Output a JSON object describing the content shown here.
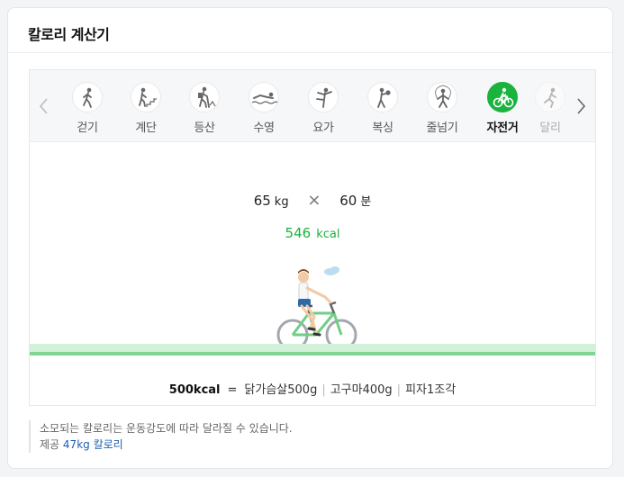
{
  "card": {
    "title": "칼로리 계산기"
  },
  "tabs": [
    {
      "label": "걷기",
      "icon": "walking-icon",
      "active": false
    },
    {
      "label": "계단",
      "icon": "stairs-icon",
      "active": false
    },
    {
      "label": "등산",
      "icon": "hiking-icon",
      "active": false
    },
    {
      "label": "수영",
      "icon": "swimming-icon",
      "active": false
    },
    {
      "label": "요가",
      "icon": "yoga-icon",
      "active": false
    },
    {
      "label": "복싱",
      "icon": "boxing-icon",
      "active": false
    },
    {
      "label": "줄넘기",
      "icon": "jump-rope-icon",
      "active": false
    },
    {
      "label": "자전거",
      "icon": "bicycle-icon",
      "active": true
    },
    {
      "label": "달리",
      "icon": "running-icon",
      "active": false
    }
  ],
  "calculator": {
    "weight_value": "65",
    "weight_unit": "kg",
    "times_symbol": "×",
    "duration_value": "60",
    "duration_unit": "분",
    "result_value": "546",
    "result_unit": "kcal"
  },
  "foods": {
    "kcal_label": "500kcal",
    "equals": "=",
    "items": [
      "닭가슴살500g",
      "고구마400g",
      "피자1조각"
    ]
  },
  "note": {
    "text": "소모되는 칼로리는 운동강도에 따라 달라질 수 있습니다.",
    "provider_label": "제공",
    "provider_link": "47kg 칼로리"
  },
  "colors": {
    "accent": "#19b33d",
    "link": "#1d5fb3",
    "ground": "#82d494"
  }
}
